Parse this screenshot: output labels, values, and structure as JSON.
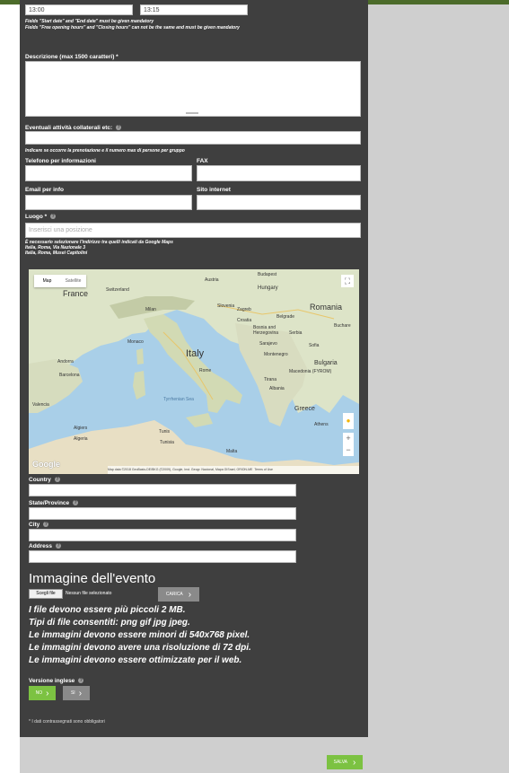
{
  "times": {
    "start_value": "13:00",
    "end_value": "13:15"
  },
  "notes_top": {
    "line1": "Fields \"Start date\" and \"End date\" must be given mandatory",
    "line2": "Fields \"Free opening hours\" and \"Closing hours\" can not be the same and must be given mandatory"
  },
  "description": {
    "label": "Descrizione (max 1500 caratteri) *"
  },
  "collateral": {
    "label": "Eventuali attività collaterali etc:",
    "hint": "Indicare se occorre la prenotazione e il numero max di persone per gruppo"
  },
  "contact": {
    "phone_label": "Telefono per informazioni",
    "fax_label": "FAX",
    "email_label": "Email per info",
    "website_label": "Sito internet"
  },
  "place": {
    "label": "Luogo *",
    "placeholder": "Inserisci una posizione",
    "hint1": "È necessario selezionare l'indirizzo tra quelli indicati da Google Maps",
    "hint2": "Italia, Roma, Via Nazionale 3",
    "hint3": "Italia, Roma, Musei Capitolini"
  },
  "map": {
    "tab_map": "Map",
    "tab_satellite": "Satellite",
    "zoom_in": "+",
    "zoom_out": "−",
    "google": "Google",
    "attribution": "Map data ©2018 GeoBasis-DE/BKG (©2009), Google, Inst. Geogr. Nacional, Mapa GISrael, ORION-ME",
    "terms": "Terms of Use",
    "labels": {
      "france": "France",
      "switzerland": "Switzerland",
      "austria": "Austria",
      "hungary": "Hungary",
      "romania": "Romania",
      "italy": "Italy",
      "croatia": "Croatia",
      "serbia": "Serbia",
      "bosnia": "Bosnia and Herzegovina",
      "montenegro": "Montenegro",
      "bulgaria": "Bulgaria",
      "albania": "Albania",
      "greece": "Greece",
      "tunisia": "Tunisia",
      "algeria": "Algeria",
      "malta": "Malta",
      "rome": "Rome",
      "barcelona": "Barcelona",
      "valencia": "Valencia",
      "milan": "Milan",
      "tyrrhenian": "Tyrrhenian Sea",
      "athens": "Athens",
      "sofia": "Sofia",
      "budapest": "Budapest",
      "zagreb": "Zagreb",
      "belgrade": "Belgrade",
      "bucharest": "Buchare",
      "tirana": "Tirana",
      "macedonia": "Macedonia (FYROM)",
      "skopje": "Skopje",
      "monaco": "Monaco",
      "andorra": "Andorra",
      "tunis": "Tunis",
      "algiers": "Algiers",
      "sarajevo": "Sarajevo"
    }
  },
  "address": {
    "country_label": "Country",
    "state_label": "State/Province",
    "city_label": "City",
    "address_label": "Address"
  },
  "image_section": {
    "title": "Immagine dell'evento",
    "choose_file": "Scegli file",
    "no_file": "Nessun file selezionato",
    "upload": "CARICA",
    "rule1": "I file devono essere più piccoli 2 MB.",
    "rule2": "Tipi di file consentiti: png gif jpg jpeg.",
    "rule3": "Le immagini devono essere minori di 540x768 pixel.",
    "rule4": "Le immagini devono avere una risoluzione di 72 dpi.",
    "rule5": "Le immagini devono essere ottimizzate per il web."
  },
  "english": {
    "label": "Versione inglese",
    "yes": "NO",
    "no": "SI"
  },
  "required_note": "* I dati contrassegnati sono obbligatori",
  "save": "SALVA",
  "colors": {
    "panel": "#3f3f3f",
    "green": "#7cc242",
    "grey_btn": "#8a8a8a",
    "topbar": "#4c6b2a"
  },
  "icons": {
    "arrow": "chevron-right-icon",
    "help": "help-icon",
    "fullscreen": "fullscreen-icon",
    "pegman": "pegman-icon"
  }
}
